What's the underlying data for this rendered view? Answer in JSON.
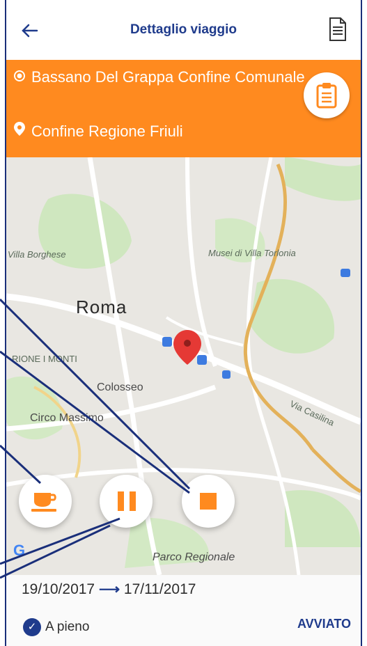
{
  "header": {
    "title": "Dettaglio viaggio",
    "back_icon": "arrow-left-icon",
    "doc_icon": "document-icon"
  },
  "trip": {
    "origin": "Bassano Del Grappa Confine Comunale",
    "destination": "Confine Regione Friuli",
    "origin_icon": "radio-dot-icon",
    "destination_icon": "location-pin-icon",
    "clipboard_icon": "clipboard-icon"
  },
  "map": {
    "city": "Roma",
    "labels": {
      "villa_borghese": "Villa Borghese",
      "musei": "Musei di Villa Torlonia",
      "rione_monti": "RIONE I MONTI",
      "colosseo": "Colosseo",
      "circo_massimo": "Circo Massimo",
      "via_casilina": "Via Casilina",
      "parco": "Parco Regionale"
    }
  },
  "actions": {
    "coffee_icon": "coffee-cup-icon",
    "pause_icon": "pause-icon",
    "stop_icon": "stop-icon"
  },
  "footer": {
    "start_date": "19/10/2017",
    "arrow": "⟶",
    "end_date": "17/11/2017",
    "load_label": "A pieno",
    "status": "AVVIATO"
  },
  "colors": {
    "accent": "#1f3b8c",
    "orange": "#ff8a1f",
    "pin_red": "#e53935"
  }
}
